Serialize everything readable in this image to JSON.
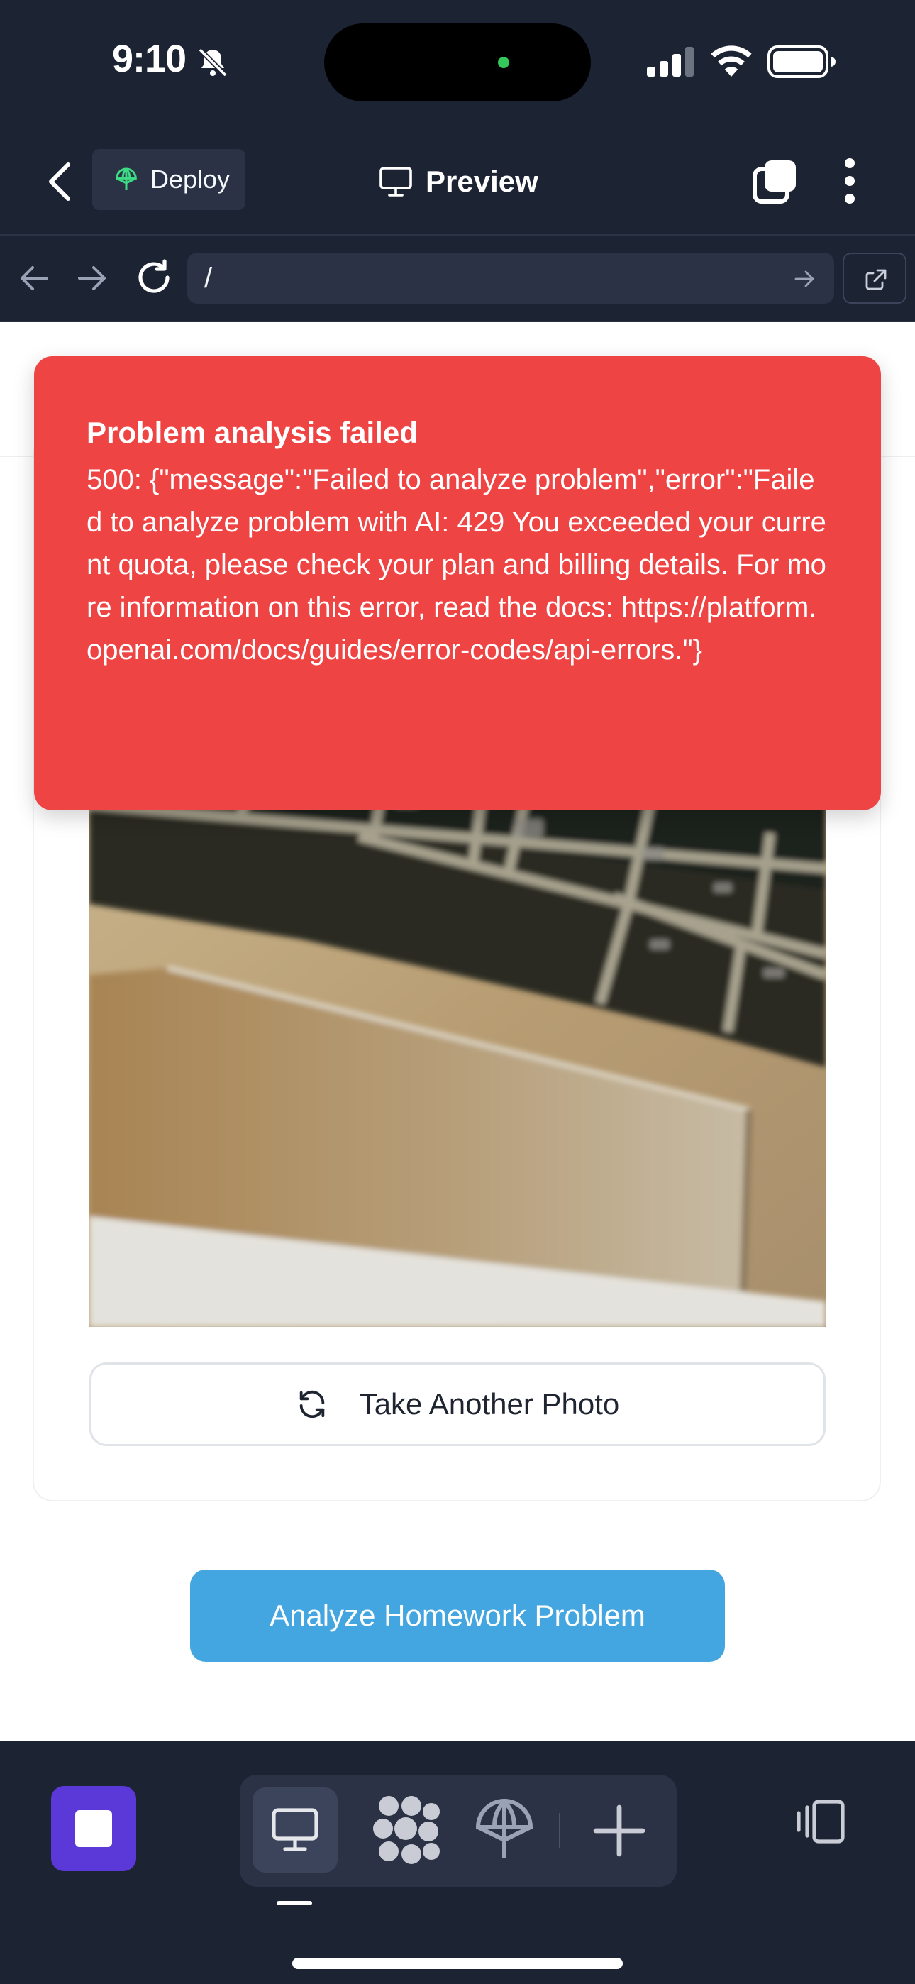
{
  "status_bar": {
    "time": "9:10",
    "icons": [
      "bell-slash-icon",
      "signal-icon",
      "wifi-icon",
      "battery-icon"
    ]
  },
  "header": {
    "deploy_label": "Deploy",
    "preview_label": "Preview",
    "icons": [
      "back-chevron-icon",
      "deploy-icon",
      "monitor-icon",
      "tabs-icon",
      "more-icon"
    ]
  },
  "browser": {
    "url": "/",
    "icons": [
      "arrow-left-icon",
      "arrow-right-icon",
      "reload-icon",
      "go-arrow-icon",
      "external-link-icon"
    ]
  },
  "toast": {
    "title": "Problem analysis failed",
    "message": "500: {\"message\":\"Failed to analyze problem\",\"error\":\"Failed to analyze problem with AI: 429 You exceeded your current quota, please check your plan and billing details. For more information on this error, read the docs: https://platform.openai.com/docs/guides/error-codes/api-errors.\"}",
    "color": "#ef4444"
  },
  "main": {
    "retake_label": "Take Another Photo",
    "analyze_label": "Analyze Homework Problem",
    "analyze_color": "#44a6e0",
    "photo_icon": "keyboard-photo"
  },
  "toolbar": {
    "icons": [
      "stop-icon",
      "monitor-icon",
      "ai-agent-icon",
      "deploy-icon",
      "plus-icon",
      "layout-toggle-icon"
    ],
    "accent": "#5b39d9"
  }
}
